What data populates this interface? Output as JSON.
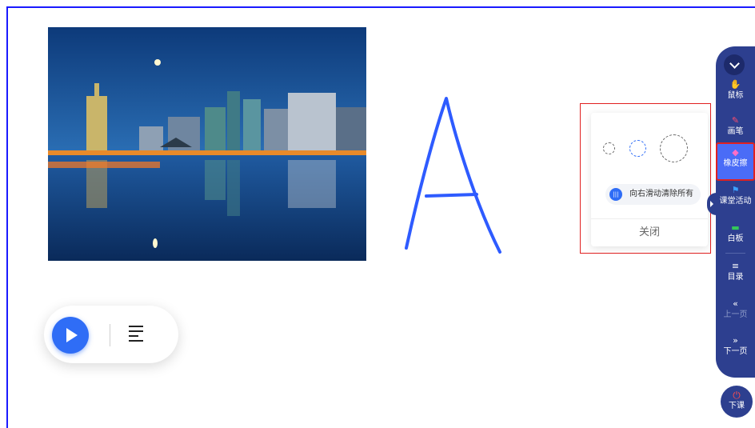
{
  "eraser_popup": {
    "slide_clear_label": "向右滑动清除所有",
    "slide_knob_glyph": "|||",
    "close_label": "关闭"
  },
  "toolbar": {
    "collapse_icon": "chevron-down-icon",
    "items": [
      {
        "label": "鼠标",
        "icon": "hand-icon",
        "glyph": "✋",
        "color": "#ff9f1a"
      },
      {
        "label": "画笔",
        "icon": "pen-icon",
        "glyph": "✎",
        "color": "#ff4d6d"
      },
      {
        "label": "橡皮擦",
        "icon": "eraser-icon",
        "glyph": "◆",
        "color": "#ff6ec7",
        "active": true
      },
      {
        "label": "课堂活动",
        "icon": "flag-icon",
        "glyph": "⚑",
        "color": "#3aa0ff"
      },
      {
        "label": "白板",
        "icon": "whiteboard-icon",
        "glyph": "▬",
        "color": "#34c759"
      },
      {
        "label": "目录",
        "icon": "list-icon",
        "glyph": "≡",
        "color": "#ffffff"
      },
      {
        "label": "上一页",
        "icon": "double-left-icon",
        "glyph": "«",
        "color": "#ffffff",
        "dim": true
      },
      {
        "label": "下一页",
        "icon": "double-right-icon",
        "glyph": "»",
        "color": "#ffffff"
      }
    ],
    "end_class": {
      "label": "下课",
      "icon": "power-icon",
      "glyph": "⏻",
      "color": "#ff4d4d"
    }
  },
  "player": {
    "play_icon": "play-icon",
    "menu_icon": "menu-lines-icon"
  },
  "colors": {
    "accent": "#2f6df6",
    "toolbar_bg": "#2d3f8f",
    "highlight": "#e02020",
    "handwriting": "#2e5bff"
  }
}
